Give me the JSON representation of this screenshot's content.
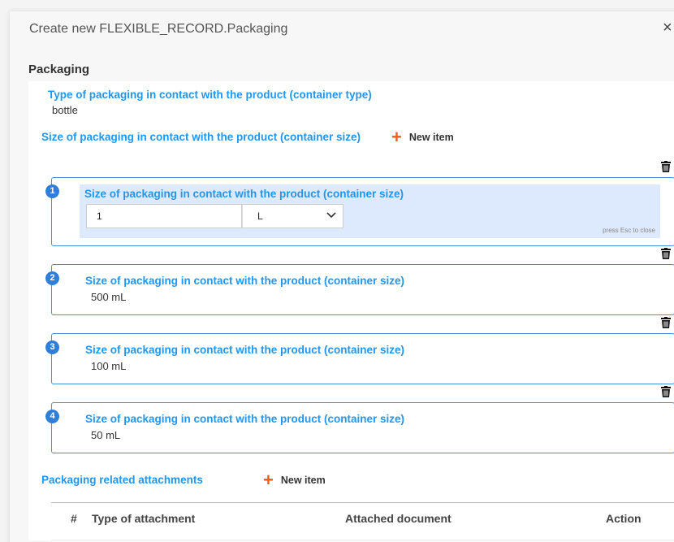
{
  "dialog": {
    "title": "Create new FLEXIBLE_RECORD.Packaging",
    "close_icon": "×"
  },
  "section": {
    "title": "Packaging"
  },
  "container_type": {
    "label": "Type of packaging in contact with the product (container type)",
    "value": "bottle"
  },
  "container_size": {
    "label": "Size of packaging in contact with the product (container size)",
    "new_item": "New item",
    "items": [
      {
        "number": "1",
        "label": "Size of packaging in contact with the product (container size)",
        "editing": true,
        "quantity": "1",
        "unit": "L",
        "hint": "press Esc to close"
      },
      {
        "number": "2",
        "label": "Size of packaging in contact with the product (container size)",
        "value": "500  mL"
      },
      {
        "number": "3",
        "label": "Size of packaging in contact with the product (container size)",
        "value": "100  mL"
      },
      {
        "number": "4",
        "label": "Size of packaging in contact with the product (container size)",
        "value": "50  mL"
      }
    ]
  },
  "attachments": {
    "label": "Packaging related attachments",
    "new_item": "New item",
    "columns": [
      "#",
      "Type of attachment",
      "Attached document",
      "Action"
    ]
  },
  "colors": {
    "accent": "#2196f3",
    "plus": "#ff5722",
    "border": "#4a90e2",
    "edit_bg": "#dde9fc"
  },
  "icons": {
    "plus": "plus-icon",
    "trash": "trash-icon",
    "chevron": "chevron-down-icon",
    "close": "close-icon"
  }
}
